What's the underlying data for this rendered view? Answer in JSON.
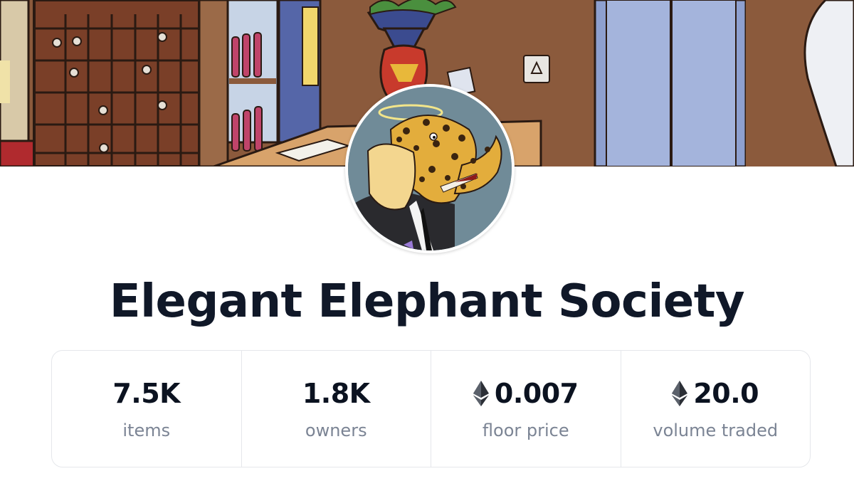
{
  "collection": {
    "name": "Elegant Elephant Society"
  },
  "stats": [
    {
      "value": "7.5K",
      "label": "items",
      "currency_icon": null
    },
    {
      "value": "1.8K",
      "label": "owners",
      "currency_icon": null
    },
    {
      "value": "0.007",
      "label": "floor price",
      "currency_icon": "ethereum-icon"
    },
    {
      "value": "20.0",
      "label": "volume traded",
      "currency_icon": "ethereum-icon"
    }
  ],
  "colors": {
    "title": "#101828",
    "stat_value": "#0b1220",
    "stat_label": "#7b8494",
    "border": "#e5e7eb"
  }
}
